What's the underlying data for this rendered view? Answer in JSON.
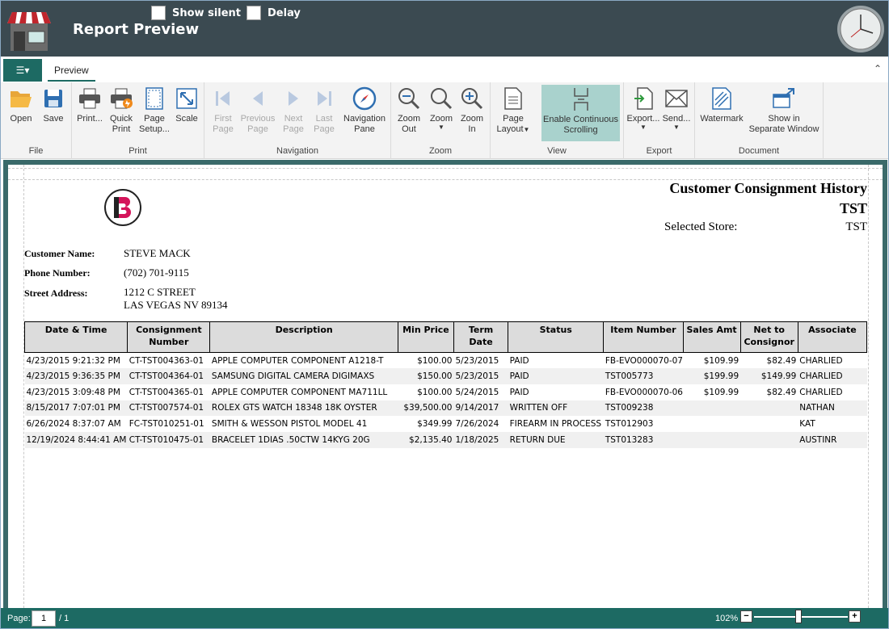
{
  "titlebar": {
    "title": "Report Preview",
    "show_silent": "Show silent",
    "delay": "Delay"
  },
  "tabs": {
    "preview": "Preview"
  },
  "ribbon": {
    "groups": {
      "file": "File",
      "print": "Print",
      "navigation": "Navigation",
      "zoom": "Zoom",
      "view": "View",
      "export": "Export",
      "document": "Document"
    },
    "buttons": {
      "open": "Open",
      "save": "Save",
      "print": "Print...",
      "quick_print_1": "Quick",
      "quick_print_2": "Print",
      "page_setup_1": "Page",
      "page_setup_2": "Setup...",
      "scale": "Scale",
      "first_page_1": "First",
      "first_page_2": "Page",
      "prev_page_1": "Previous",
      "prev_page_2": "Page",
      "next_page_1": "Next",
      "next_page_2": "Page",
      "last_page_1": "Last",
      "last_page_2": "Page",
      "nav_pane_1": "Navigation",
      "nav_pane_2": "Pane",
      "zoom_out_1": "Zoom",
      "zoom_out_2": "Out",
      "zoom": "Zoom",
      "zoom_in_1": "Zoom",
      "zoom_in_2": "In",
      "page_layout_1": "Page",
      "page_layout_2": "Layout",
      "continuous_1": "Enable Continuous",
      "continuous_2": "Scrolling",
      "export": "Export...",
      "send": "Send...",
      "watermark": "Watermark",
      "separate_1": "Show in",
      "separate_2": "Separate Window"
    }
  },
  "report": {
    "title": "Customer Consignment History",
    "store_code": "TST",
    "selected_store_label": "Selected Store:",
    "selected_store_value": "TST",
    "customer_name_label": "Customer Name:",
    "customer_name": "STEVE MACK",
    "phone_label": "Phone Number:",
    "phone": "(702) 701-9115",
    "address_label": "Street Address:",
    "address_line1": "1212 C STREET",
    "address_line2": "LAS VEGAS NV 89134",
    "columns": [
      "Date & Time",
      "Consignment Number",
      "Description",
      "Min Price",
      "Term Date",
      "Status",
      "Item Number",
      "Sales Amt",
      "Net to Consignor",
      "Associate"
    ],
    "rows": [
      [
        "4/23/2015 9:21:32 PM",
        "CT-TST004363-01",
        "APPLE COMPUTER COMPONENT A1218-T",
        "$100.00",
        "5/23/2015",
        "PAID",
        "FB-EVO000070-07",
        "$109.99",
        "$82.49",
        "CHARLIED"
      ],
      [
        "4/23/2015 9:36:35 PM",
        "CT-TST004364-01",
        "SAMSUNG DIGITAL CAMERA DIGIMAXS",
        "$150.00",
        "5/23/2015",
        "PAID",
        "TST005773",
        "$199.99",
        "$149.99",
        "CHARLIED"
      ],
      [
        "4/23/2015 3:09:48 PM",
        "CT-TST004365-01",
        "APPLE COMPUTER COMPONENT MA711LL",
        "$100.00",
        "5/24/2015",
        "PAID",
        "FB-EVO000070-06",
        "$109.99",
        "$82.49",
        "CHARLIED"
      ],
      [
        "8/15/2017 7:07:01 PM",
        "CT-TST007574-01",
        "ROLEX GTS WATCH 18348 18K OYSTER",
        "$39,500.00",
        "9/14/2017",
        "WRITTEN OFF",
        "TST009238",
        "",
        "",
        "NATHAN"
      ],
      [
        "6/26/2024 8:37:07 AM",
        "FC-TST010251-01",
        "SMITH & WESSON PISTOL MODEL 41",
        "$349.99",
        "7/26/2024",
        "FIREARM IN PROCESS",
        "TST012903",
        "",
        "",
        "KAT"
      ],
      [
        "12/19/2024 8:44:41 AM",
        "CT-TST010475-01",
        "BRACELET 1DIAS .50CTW 14KYG 20G",
        "$2,135.40",
        "1/18/2025",
        "RETURN DUE",
        "TST013283",
        "",
        "",
        "AUSTINR"
      ]
    ]
  },
  "statusbar": {
    "page_label": "Page:",
    "page_value": "1",
    "page_total": "/ 1",
    "zoom": "102%",
    "zoom_level": 0.47
  },
  "colors": {
    "titlebar": "#3b4a51",
    "accent": "#1d6a63",
    "active_button": "#a9d2cd",
    "logo_red": "#d4145a"
  }
}
